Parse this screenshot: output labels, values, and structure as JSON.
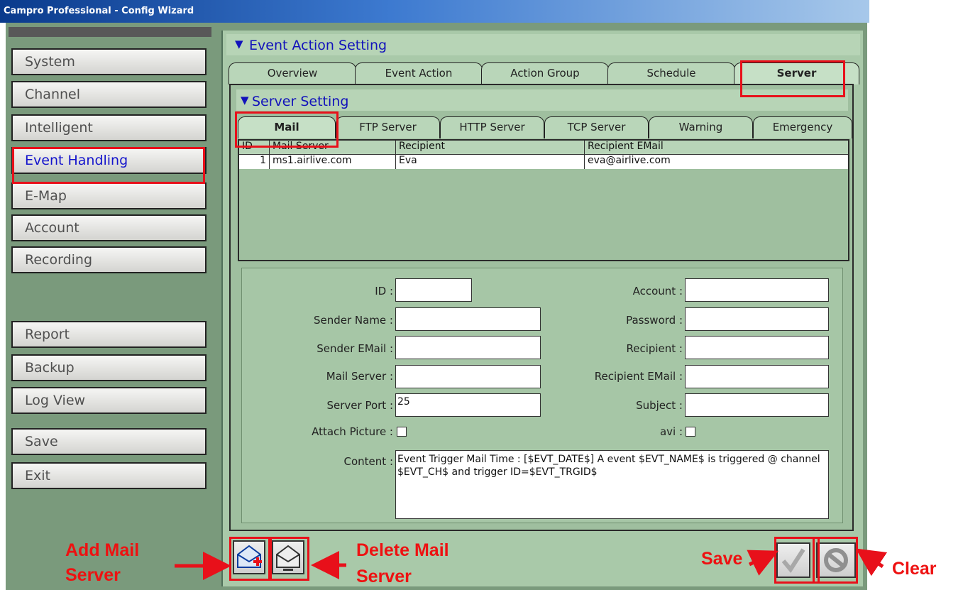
{
  "window": {
    "title": "Campro Professional - Config Wizard"
  },
  "sidebar": {
    "items": [
      {
        "label": "System"
      },
      {
        "label": "Channel"
      },
      {
        "label": "Intelligent"
      },
      {
        "label": "Event Handling"
      },
      {
        "label": "E-Map"
      },
      {
        "label": "Account"
      },
      {
        "label": "Recording"
      },
      {
        "label": "Report"
      },
      {
        "label": "Backup"
      },
      {
        "label": "Log View"
      },
      {
        "label": "Save"
      },
      {
        "label": "Exit"
      }
    ]
  },
  "main": {
    "header": "Event Action Setting",
    "tabs": [
      "Overview",
      "Event Action",
      "Action Group",
      "Schedule",
      "Server"
    ],
    "server": {
      "header": "Server Setting",
      "subtabs": [
        "Mail",
        "FTP Server",
        "HTTP Server",
        "TCP Server",
        "Warning",
        "Emergency"
      ],
      "table": {
        "columns": [
          "ID",
          "Mail Server",
          "Recipient",
          "Recipient EMail"
        ],
        "rows": [
          {
            "id": "1",
            "mail_server": "ms1.airlive.com",
            "recipient": "Eva",
            "recipient_email": "eva@airlive.com"
          }
        ]
      },
      "form": {
        "id_label": "ID :",
        "id_value": "",
        "sender_name_label": "Sender Name :",
        "sender_name_value": "",
        "sender_email_label": "Sender EMail :",
        "sender_email_value": "",
        "mail_server_label": "Mail Server :",
        "mail_server_value": "",
        "server_port_label": "Server Port :",
        "server_port_value": "25",
        "attach_picture_label": "Attach Picture :",
        "account_label": "Account :",
        "account_value": "",
        "password_label": "Password :",
        "password_value": "",
        "recipient_label": "Recipient :",
        "recipient_value": "",
        "recipient_email_label": "Recipient EMail :",
        "recipient_email_value": "",
        "subject_label": "Subject :",
        "subject_value": "",
        "avi_label": "avi :",
        "content_label": "Content :",
        "content_value": "Event Trigger Mail Time : [$EVT_DATE$] A event $EVT_NAME$ is triggered @ channel $EVT_CH$ and trigger ID=$EVT_TRGID$"
      }
    }
  },
  "callouts": {
    "add_line1": "Add Mail",
    "add_line2": "Server",
    "delete_line1": "Delete Mail",
    "delete_line2": "Server",
    "save": "Save",
    "clear": "Clear"
  },
  "colors": {
    "highlight": "#e8101a",
    "panel": "#a9c9a9",
    "active_text": "#1414cc"
  }
}
